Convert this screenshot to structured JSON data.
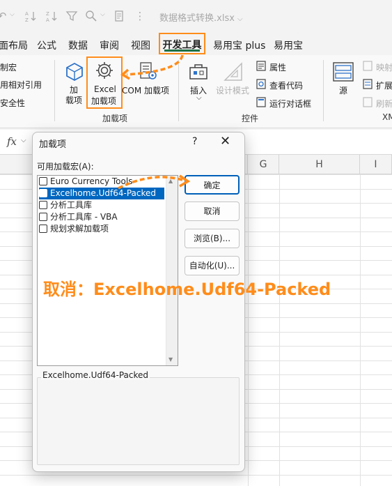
{
  "titlebar": {
    "doc_title": "数据格式转换.xlsx",
    "dropdown_glyph": "⌵"
  },
  "tabs": [
    {
      "label": "面布局"
    },
    {
      "label": "公式"
    },
    {
      "label": "数据"
    },
    {
      "label": "审阅"
    },
    {
      "label": "视图"
    },
    {
      "label": "开发工具"
    },
    {
      "label": "易用宝 plus"
    },
    {
      "label": "易用宝"
    }
  ],
  "ribbon": {
    "code_group": {
      "items": [
        "制宏",
        "用相对引用",
        "安全性"
      ]
    },
    "addins_group": {
      "label": "加载项",
      "addins_btn": [
        "加",
        "载项"
      ],
      "excel_addins_btn": [
        "Excel",
        "加载项"
      ],
      "com_addins_btn": "COM 加载项"
    },
    "controls_group": {
      "label": "控件",
      "insert_btn": "插入",
      "design_mode_btn": "设计模式",
      "properties_btn": "属性",
      "view_code_btn": "查看代码",
      "run_dialog_btn": "运行对话框"
    },
    "xml_group": {
      "label": "XM",
      "source_btn": "源",
      "map_btn": "映射",
      "expand_btn": "扩展",
      "refresh_btn": "刷新"
    }
  },
  "formula_bar": {
    "fx": "fx"
  },
  "columns": [
    "G",
    "H",
    "I"
  ],
  "dialog": {
    "title": "加载项",
    "help": "?",
    "close": "✕",
    "list_label": "可用加载宏(A):",
    "items": [
      {
        "label": "Euro Currency Tools",
        "checked": false,
        "selected": false
      },
      {
        "label": "Excelhome.Udf64-Packed",
        "checked": false,
        "selected": true
      },
      {
        "label": "分析工具库",
        "checked": false,
        "selected": false
      },
      {
        "label": "分析工具库 - VBA",
        "checked": false,
        "selected": false
      },
      {
        "label": "规划求解加载项",
        "checked": false,
        "selected": false
      }
    ],
    "ok": "确定",
    "cancel": "取消",
    "browse": "浏览(B)...",
    "automation": "自动化(U)...",
    "description_title": "Excelhome.Udf64-Packed"
  },
  "annotation": "取消：Excelhome.Udf64-Packed",
  "colors": {
    "highlight": "#ff8c1a",
    "selection": "#0067c0",
    "ok_border": "#005fb8",
    "tab_underline": "#1e7145"
  }
}
